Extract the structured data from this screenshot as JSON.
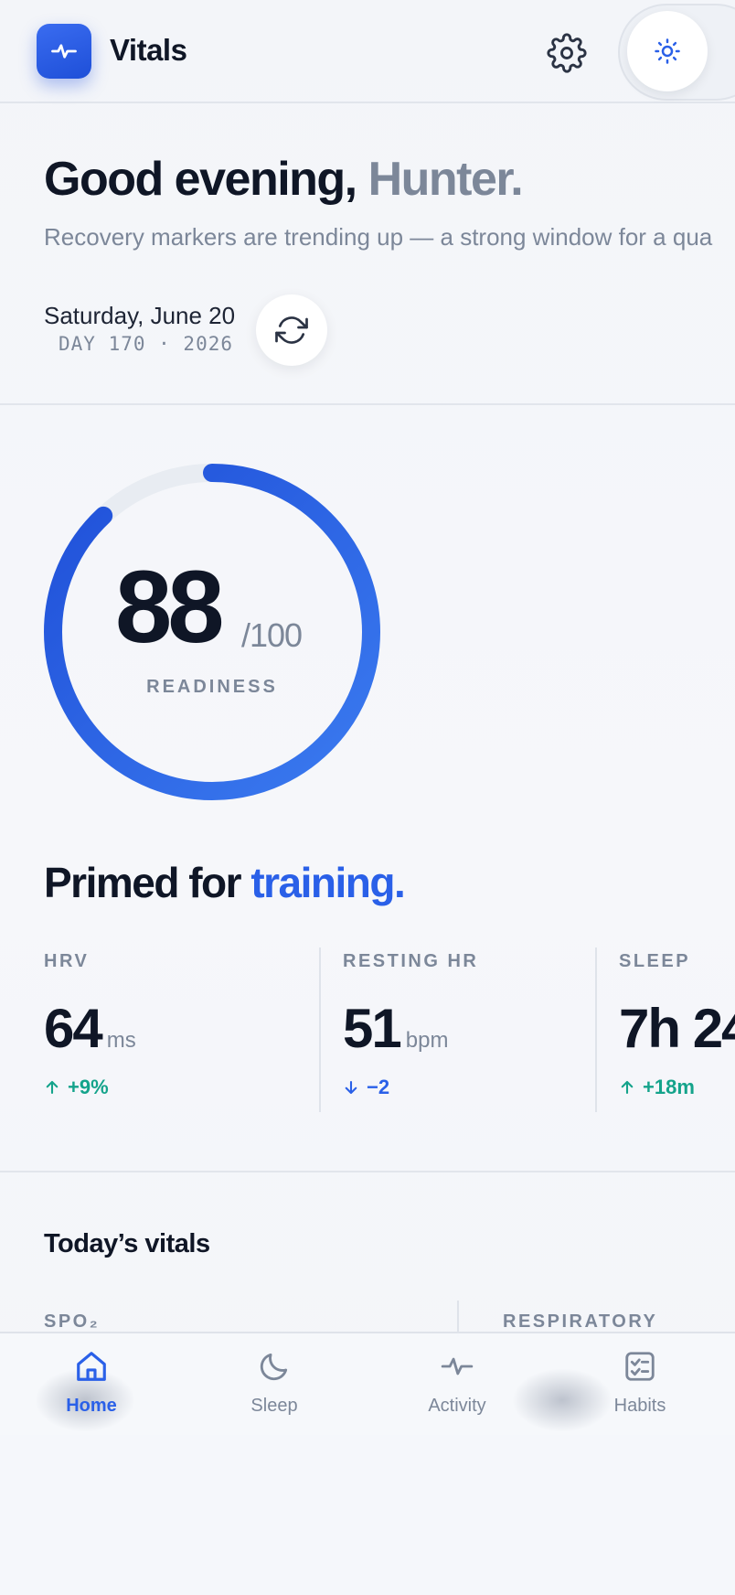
{
  "app": {
    "title": "Vitals"
  },
  "header": {
    "settings_icon": "gear-icon",
    "theme_icon": "sun-icon",
    "accent": "#2a60e8"
  },
  "greeting": {
    "prefix": "Good evening, ",
    "name": "Hunter.",
    "subtitle": "Recovery markers are trending up — a strong window for a qua"
  },
  "date": {
    "main": "Saturday, June 20",
    "sub": "DAY 170 · 2026"
  },
  "readiness": {
    "score": "88",
    "max": "/100",
    "label": "READINESS",
    "fraction": 0.88
  },
  "status": {
    "prefix": "Primed for ",
    "accent": "training."
  },
  "metrics": [
    {
      "label": "HRV",
      "value": "64",
      "unit": "ms",
      "delta": "+9%",
      "direction": "up",
      "color": "#14a38b"
    },
    {
      "label": "RESTING HR",
      "value": "51",
      "unit": "bpm",
      "delta": "−2",
      "direction": "down",
      "color": "#2a60e8"
    },
    {
      "label": "SLEEP",
      "value": "7h 24",
      "unit": "",
      "delta": "+18m",
      "direction": "up",
      "color": "#14a38b"
    }
  ],
  "today": {
    "title": "Today’s vitals",
    "labels": [
      "SPO₂",
      "RESPIRATORY"
    ]
  },
  "nav": [
    {
      "label": "Home",
      "icon": "home-icon",
      "active": true
    },
    {
      "label": "Sleep",
      "icon": "moon-icon",
      "active": false
    },
    {
      "label": "Activity",
      "icon": "pulse-icon",
      "active": false
    },
    {
      "label": "Habits",
      "icon": "checklist-icon",
      "active": false
    }
  ]
}
